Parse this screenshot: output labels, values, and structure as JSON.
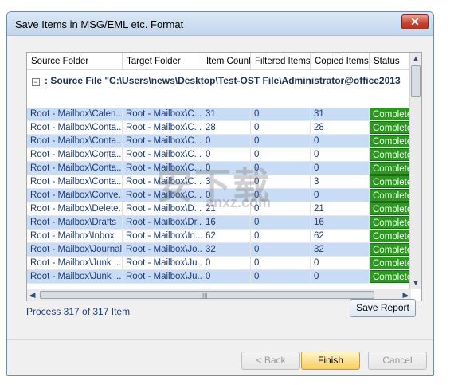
{
  "window": {
    "title": "Save Items in MSG/EML etc. Format",
    "close_symbol": "✕"
  },
  "columns": [
    "Source Folder",
    "Target Folder",
    "Item Count",
    "Filtered Items",
    "Copied Items",
    "Status"
  ],
  "group": {
    "toggle": "−",
    "label": ": Source File \"C:\\Users\\news\\Desktop\\Test-OST File\\Administrator@office2013"
  },
  "rows": [
    {
      "source": "Root - Mailbox\\Calen...",
      "target": "Root - Mailbox\\C...",
      "count": "31",
      "filtered": "0",
      "copied": "31",
      "status": "Completed"
    },
    {
      "source": "Root - Mailbox\\Conta...",
      "target": "Root - Mailbox\\C...",
      "count": "28",
      "filtered": "0",
      "copied": "28",
      "status": "Completed"
    },
    {
      "source": "Root - Mailbox\\Conta...",
      "target": "Root - Mailbox\\C...",
      "count": "0",
      "filtered": "0",
      "copied": "0",
      "status": "Completed"
    },
    {
      "source": "Root - Mailbox\\Conta...",
      "target": "Root - Mailbox\\C...",
      "count": "0",
      "filtered": "0",
      "copied": "0",
      "status": "Completed"
    },
    {
      "source": "Root - Mailbox\\Conta...",
      "target": "Root - Mailbox\\C...",
      "count": "0",
      "filtered": "0",
      "copied": "0",
      "status": "Completed"
    },
    {
      "source": "Root - Mailbox\\Conta...",
      "target": "Root - Mailbox\\C...",
      "count": "3",
      "filtered": "0",
      "copied": "3",
      "status": "Completed"
    },
    {
      "source": "Root - Mailbox\\Conve...",
      "target": "Root - Mailbox\\C...",
      "count": "0",
      "filtered": "0",
      "copied": "0",
      "status": "Completed"
    },
    {
      "source": "Root - Mailbox\\Delete...",
      "target": "Root - Mailbox\\D...",
      "count": "21",
      "filtered": "0",
      "copied": "21",
      "status": "Completed"
    },
    {
      "source": "Root - Mailbox\\Drafts",
      "target": "Root - Mailbox\\Dr...",
      "count": "16",
      "filtered": "0",
      "copied": "16",
      "status": "Completed"
    },
    {
      "source": "Root - Mailbox\\Inbox",
      "target": "Root - Mailbox\\In...",
      "count": "62",
      "filtered": "0",
      "copied": "62",
      "status": "Completed"
    },
    {
      "source": "Root - Mailbox\\Journal",
      "target": "Root - Mailbox\\Jo...",
      "count": "32",
      "filtered": "0",
      "copied": "32",
      "status": "Completed"
    },
    {
      "source": "Root - Mailbox\\Junk ...",
      "target": "Root - Mailbox\\Ju...",
      "count": "0",
      "filtered": "0",
      "copied": "0",
      "status": "Completed"
    },
    {
      "source": "Root - Mailbox\\Junk ...",
      "target": "Root - Mailbox\\Ju...",
      "count": "0",
      "filtered": "0",
      "copied": "0",
      "status": "Completed"
    }
  ],
  "scroll": {
    "up": "▲",
    "down": "▼",
    "left": "◀",
    "right": "▶",
    "grip": "|||"
  },
  "process_text": "Process 317 of 317 Item",
  "buttons": {
    "save_report": "Save Report",
    "back": "< Back",
    "finish": "Finish",
    "cancel": "Cancel"
  },
  "watermark": {
    "main": "安下载",
    "sub": "anxz.com"
  }
}
